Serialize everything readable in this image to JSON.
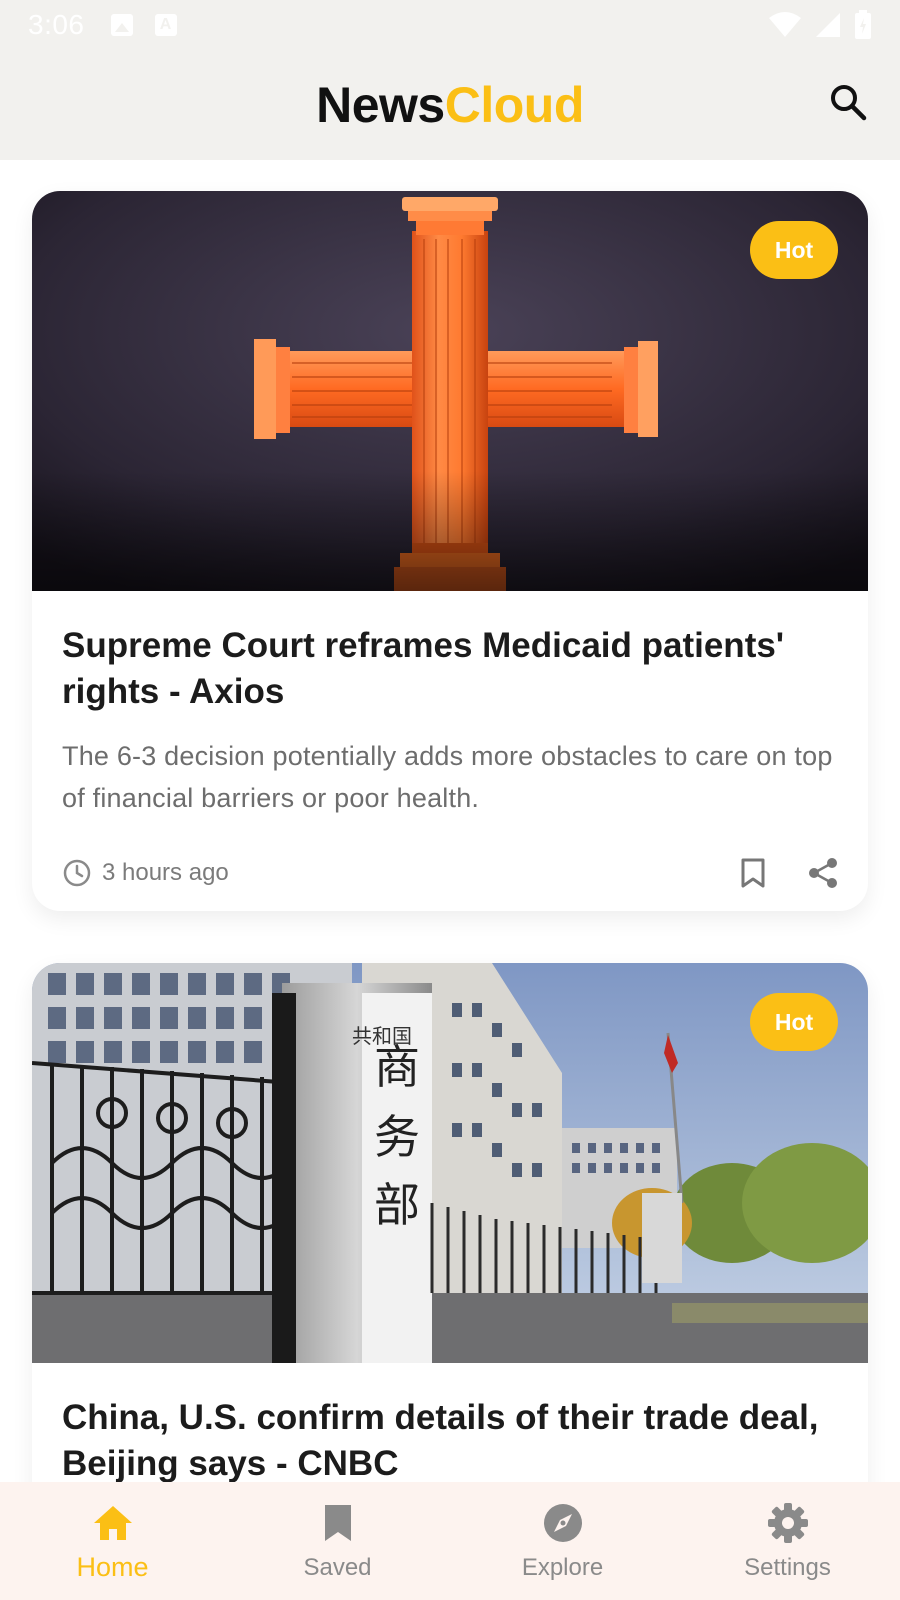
{
  "status_bar": {
    "time": "3:06",
    "icons": [
      "image-icon",
      "a-icon",
      "wifi-icon",
      "signal-icon",
      "battery-icon"
    ]
  },
  "header": {
    "brand_part1": "News",
    "brand_part2": "Cloud",
    "brand_colors": {
      "news": "#111111",
      "cloud": "#fbbf15"
    },
    "search_icon": "search-icon"
  },
  "feed": {
    "articles": [
      {
        "badge": "Hot",
        "title": "Supreme Court reframes Medicaid patients' rights - Axios",
        "description": "The 6-3 decision potentially adds more obstacles to care on top of financial barriers or poor health.",
        "time": "3 hours ago",
        "image": "orange-column-cross-illustration"
      },
      {
        "badge": "Hot",
        "title": "China, U.S. confirm details of their trade deal, Beijing says - CNBC",
        "image": "ministry-of-commerce-building-photo",
        "image_sign_text": "中华人民共和国商务部"
      }
    ]
  },
  "bottom_nav": {
    "items": [
      {
        "label": "Home",
        "icon": "home-icon",
        "active": true
      },
      {
        "label": "Saved",
        "icon": "bookmark-icon",
        "active": false
      },
      {
        "label": "Explore",
        "icon": "compass-icon",
        "active": false
      },
      {
        "label": "Settings",
        "icon": "gear-icon",
        "active": false
      }
    ]
  },
  "colors": {
    "accent": "#fbbf15",
    "header_bg": "#f2f1ee",
    "nav_bg": "#fdf3ef",
    "inactive": "#8a8a8a"
  }
}
